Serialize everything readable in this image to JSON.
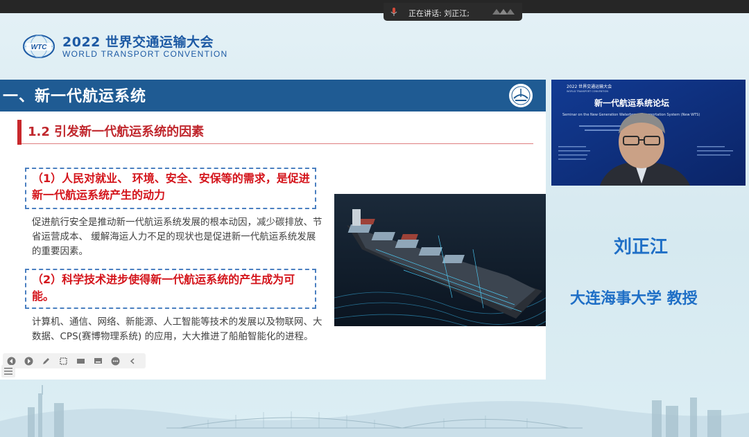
{
  "meeting": {
    "speaking_label": "正在讲话: 刘正江;"
  },
  "header": {
    "logo_text": "WTC",
    "title": "2022 世界交通运输大会",
    "subtitle": "WORLD TRANSPORT CONVENTION"
  },
  "slide": {
    "section_title": "一、新一代航运系统",
    "subsection_title": "1.2 引发新一代航运系统的因素",
    "point1": "（1）人民对就业、 环境、安全、安保等的需求，是促进新一代航运系统产生的动力",
    "point1_text": "促进航行安全是推动新一代航运系统发展的根本动因，减少碳排放、节省运营成本、 缓解海运人力不足的现状也是促进新一代航运系统发展的重要因素。",
    "point2": "（2）科学技术进步使得新一代航运系统的产生成为可能。",
    "point2_text": "计算机、通信、网络、新能源、人工智能等技术的发展以及物联网、大数据、CPS(赛博物理系统) 的应用，大大推进了船舶智能化的进程。"
  },
  "video": {
    "banner_brand": "2022 世界交通运输大会",
    "banner_brand_en": "WORLD TRANSPORT CONVENTION",
    "forum_title": "新一代航运系统论坛",
    "forum_en": "Seminar on the New Generation Waterborne Transportation System (New WTS)"
  },
  "speaker": {
    "name": "刘正江",
    "affiliation": "大连海事大学 教授"
  },
  "colors": {
    "brand_blue": "#1d5aa4",
    "slide_header": "#1f5b93",
    "accent_red": "#c0272d",
    "name_blue": "#1f6fc6"
  }
}
